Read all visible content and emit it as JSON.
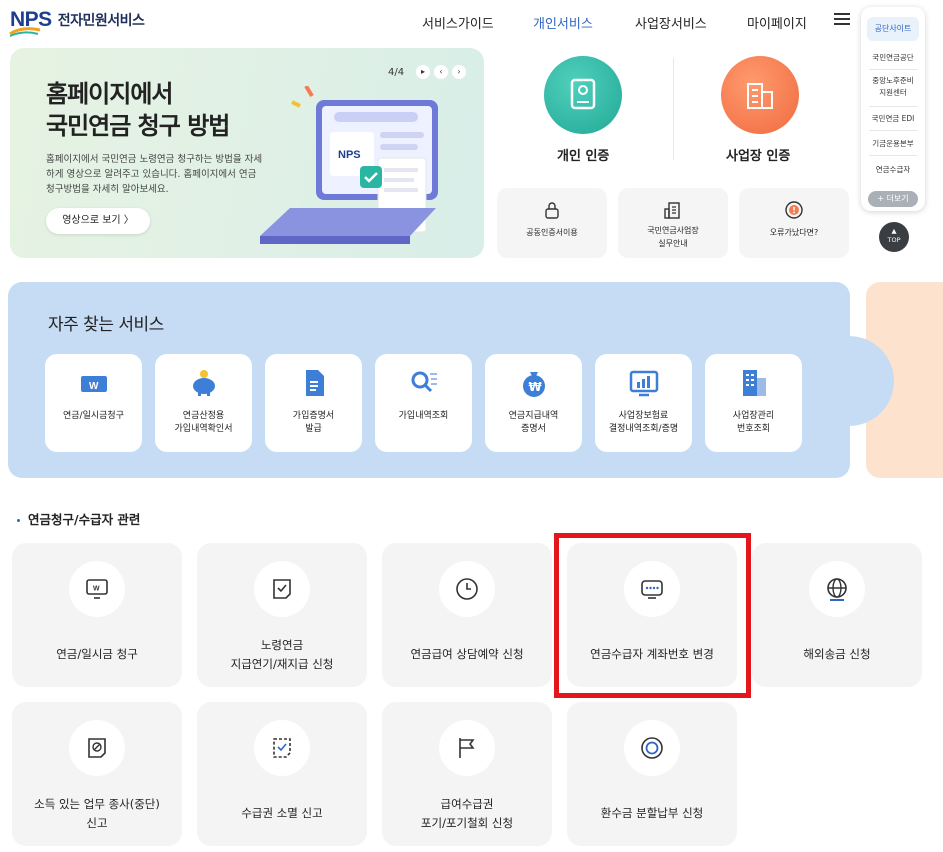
{
  "header": {
    "logo_mark": "NPS",
    "logo_text": "전자민원서비스",
    "nav": [
      "서비스가이드",
      "개인서비스",
      "사업장서비스",
      "마이페이지"
    ],
    "active_nav_color": "#2f66c4"
  },
  "side_panel": {
    "title": "공단사이트",
    "items": [
      "국민연금공단",
      "중앙노후준비\n지원센터",
      "국민연금 EDI",
      "기금운용본부",
      "연금수급자"
    ],
    "more": "+ 더보기",
    "top": "TOP"
  },
  "banner": {
    "title_line1": "홈페이지에서",
    "title_line2": "국민연금 청구 방법",
    "description": "홈페이지에서 국민연금 노령연금 청구하는 방법을 자세하게 영상으로 알려주고 있습니다. 홈페이지에서 연금 청구방법을 자세히 알아보세요.",
    "button": "영상으로 보기  〉",
    "page": "4/4",
    "laptop_logo": "NPS"
  },
  "auth": {
    "personal": "개인 인증",
    "business": "사업장 인증",
    "personal_color": "#2bb5a3",
    "business_color": "#f47c52"
  },
  "quick_cards": [
    {
      "label": "공동인증서이용",
      "icon": "lock-icon"
    },
    {
      "label": "국민연금사업장\n실무안내",
      "icon": "building-doc-icon"
    },
    {
      "label": "오류가났다면?",
      "icon": "alert-icon"
    }
  ],
  "frequent": {
    "title": "자주 찾는 서비스",
    "items": [
      {
        "label": "연금/일시금청구",
        "icon": "won-card-icon"
      },
      {
        "label": "연금산정용\n가입내역확인서",
        "icon": "piggy-bank-icon"
      },
      {
        "label": "가입증명서\n발급",
        "icon": "document-icon"
      },
      {
        "label": "가입내역조회",
        "icon": "search-list-icon"
      },
      {
        "label": "연금지급내역\n증명서",
        "icon": "money-bag-icon"
      },
      {
        "label": "사업장보험료\n결정내역조회/증명",
        "icon": "chart-monitor-icon"
      },
      {
        "label": "사업장관리\n번호조회",
        "icon": "building-icon"
      }
    ]
  },
  "section": {
    "title": "연금청구/수급자 관련",
    "services": [
      {
        "label": "연금/일시금 청구",
        "icon": "won-monitor-icon"
      },
      {
        "label": "노령연금\n지급연기/재지급 신청",
        "icon": "doc-check-icon"
      },
      {
        "label": "연금급여 상담예약 신청",
        "icon": "clock-icon"
      },
      {
        "label": "연금수급자 계좌번호 변경",
        "icon": "password-monitor-icon"
      },
      {
        "label": "해외송금 신청",
        "icon": "globe-icon"
      },
      {
        "label": "소득 있는 업무 종사(중단)\n신고",
        "icon": "doc-block-icon"
      },
      {
        "label": "수급권 소멸 신고",
        "icon": "doc-dashed-check-icon"
      },
      {
        "label": "급여수급권\n포기/포기철회 신청",
        "icon": "flag-icon"
      },
      {
        "label": "환수금 분할납부 신청",
        "icon": "coin-icon"
      }
    ]
  },
  "highlight_color": "#e3161b"
}
